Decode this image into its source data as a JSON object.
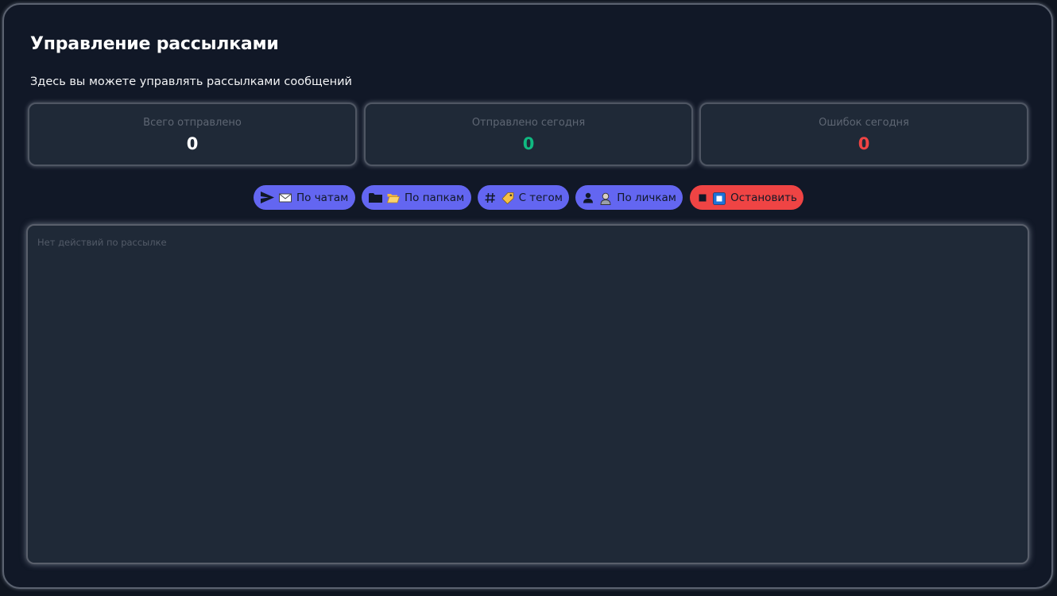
{
  "header": {
    "title": "Управление рассылками",
    "subtitle": "Здесь вы можете управлять рассылками сообщений"
  },
  "stats": [
    {
      "label": "Всего отправлено",
      "value": "0",
      "color": "#ffffff"
    },
    {
      "label": "Отправлено сегодня",
      "value": "0",
      "color": "#10b981"
    },
    {
      "label": "Ошибок сегодня",
      "value": "0",
      "color": "#ef4444"
    }
  ],
  "actions": [
    {
      "label": "По чатам",
      "icon": "send-icon",
      "emoji": "envelope-icon"
    },
    {
      "label": "По папкам",
      "icon": "folder-icon",
      "emoji": "open-folder-icon"
    },
    {
      "label": "С тегом",
      "icon": "hashtag-icon",
      "emoji": "tag-icon"
    },
    {
      "label": "По личкам",
      "icon": "user-icon",
      "emoji": "person-icon"
    },
    {
      "label": "Остановить",
      "icon": "stop-icon",
      "emoji": "stop-button-icon"
    }
  ],
  "log": {
    "empty_text": "Нет действий по рассылке"
  },
  "colors": {
    "accent": "#6366f1",
    "danger": "#ef4444",
    "success": "#10b981",
    "background": "#111827",
    "card": "#1f2937"
  }
}
